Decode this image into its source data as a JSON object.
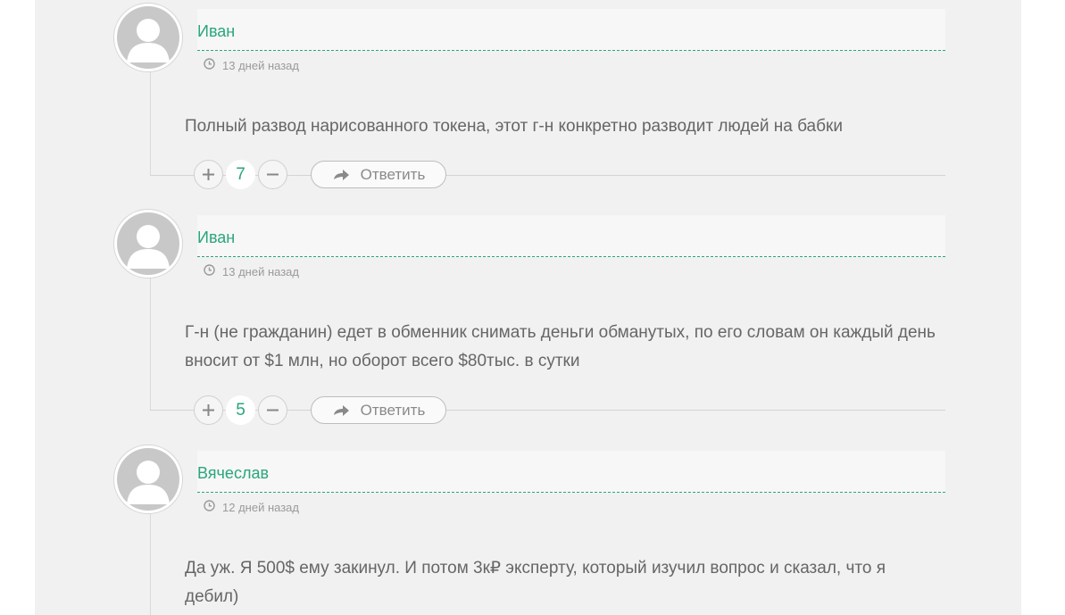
{
  "comments": [
    {
      "author": "Иван",
      "date": "13 дней назад",
      "text": "Полный развод нарисованного токена, этот г-н конкретно разводит людей на бабки",
      "votes": "7",
      "reply_label": "Ответить"
    },
    {
      "author": "Иван",
      "date": "13 дней назад",
      "text": "Г-н (не гражданин) едет в обменник снимать деньги обманутых, по его словам он каждый день вносит от $1 млн, но оборот всего $80тыс. в сутки",
      "votes": "5",
      "reply_label": "Ответить"
    },
    {
      "author": "Вячеслав",
      "date": "12 дней назад",
      "text": "Да уж. Я 500$ ему закинул. И потом 3к₽ эксперту, который изучил вопрос и сказал, что я дебил)"
    }
  ],
  "colors": {
    "accent": "#2aa67a",
    "panel_bg": "#f1f1f1",
    "text": "#666666",
    "muted": "#9a9a9a"
  },
  "icons": {
    "avatar": "default-avatar-icon",
    "date": "clock-icon",
    "upvote": "plus-icon",
    "downvote": "minus-icon",
    "reply": "reply-arrow-icon"
  }
}
